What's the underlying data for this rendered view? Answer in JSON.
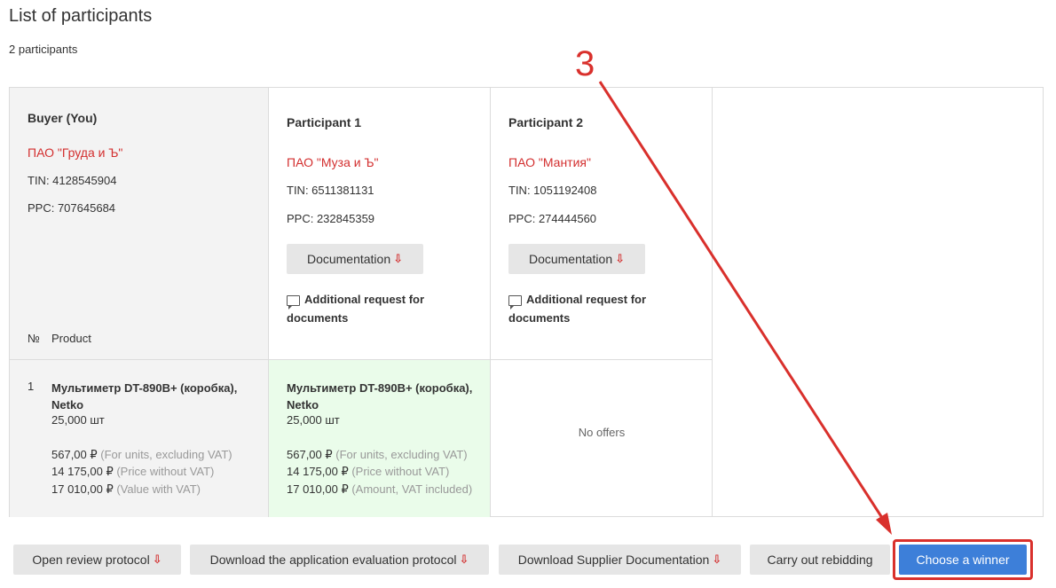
{
  "page": {
    "title": "List of participants",
    "count": "2 participants"
  },
  "buyer": {
    "heading": "Buyer (You)",
    "company": "ПАО \"Груда и Ъ\"",
    "tin": "TIN: 4128545904",
    "ppc": "PPC: 707645684",
    "col_no": "№",
    "col_product": "Product",
    "item": {
      "no": "1",
      "name": "Мультиметр DT-890B+ (коробка), Netko",
      "qty": "25,000 шт",
      "unit_price": "567,00 ₽",
      "unit_price_note": "(For units, excluding VAT)",
      "price": "14 175,00 ₽",
      "price_note": "(Price without VAT)",
      "value": "17 010,00 ₽",
      "value_note": "(Value with VAT)"
    }
  },
  "participants": [
    {
      "heading": "Participant 1",
      "company": "ПАО \"Муза и Ъ\"",
      "tin": "TIN: 6511381131",
      "ppc": "PPC: 232845359",
      "doc_button": "Documentation",
      "request_link": "Additional request for documents",
      "offer": {
        "name": "Мультиметр DT-890B+ (коробка), Netko",
        "qty": "25,000 шт",
        "unit_price": "567,00 ₽",
        "unit_price_note": "(For units, excluding VAT)",
        "price": "14 175,00 ₽",
        "price_note": "(Price without VAT)",
        "amount": "17 010,00 ₽",
        "amount_note": "(Amount, VAT included)"
      }
    },
    {
      "heading": "Participant 2",
      "company": "ПАО \"Мантия\"",
      "tin": "TIN: 1051192408",
      "ppc": "PPC: 274444560",
      "doc_button": "Documentation",
      "request_link": "Additional request for documents",
      "no_offers": "No offers"
    }
  ],
  "actions": {
    "open_review": "Open review protocol",
    "download_evaluation": "Download the application evaluation protocol",
    "download_supplier": "Download Supplier Documentation",
    "rebidding": "Carry out rebidding",
    "choose_winner": "Choose a winner"
  },
  "annotation": {
    "step": "3"
  },
  "colors": {
    "accent_red": "#d32f2f",
    "primary_blue": "#3d7fd9",
    "winner_bg": "#eafcea",
    "buyer_bg": "#f3f3f3",
    "annotation_red": "#d9302c"
  }
}
